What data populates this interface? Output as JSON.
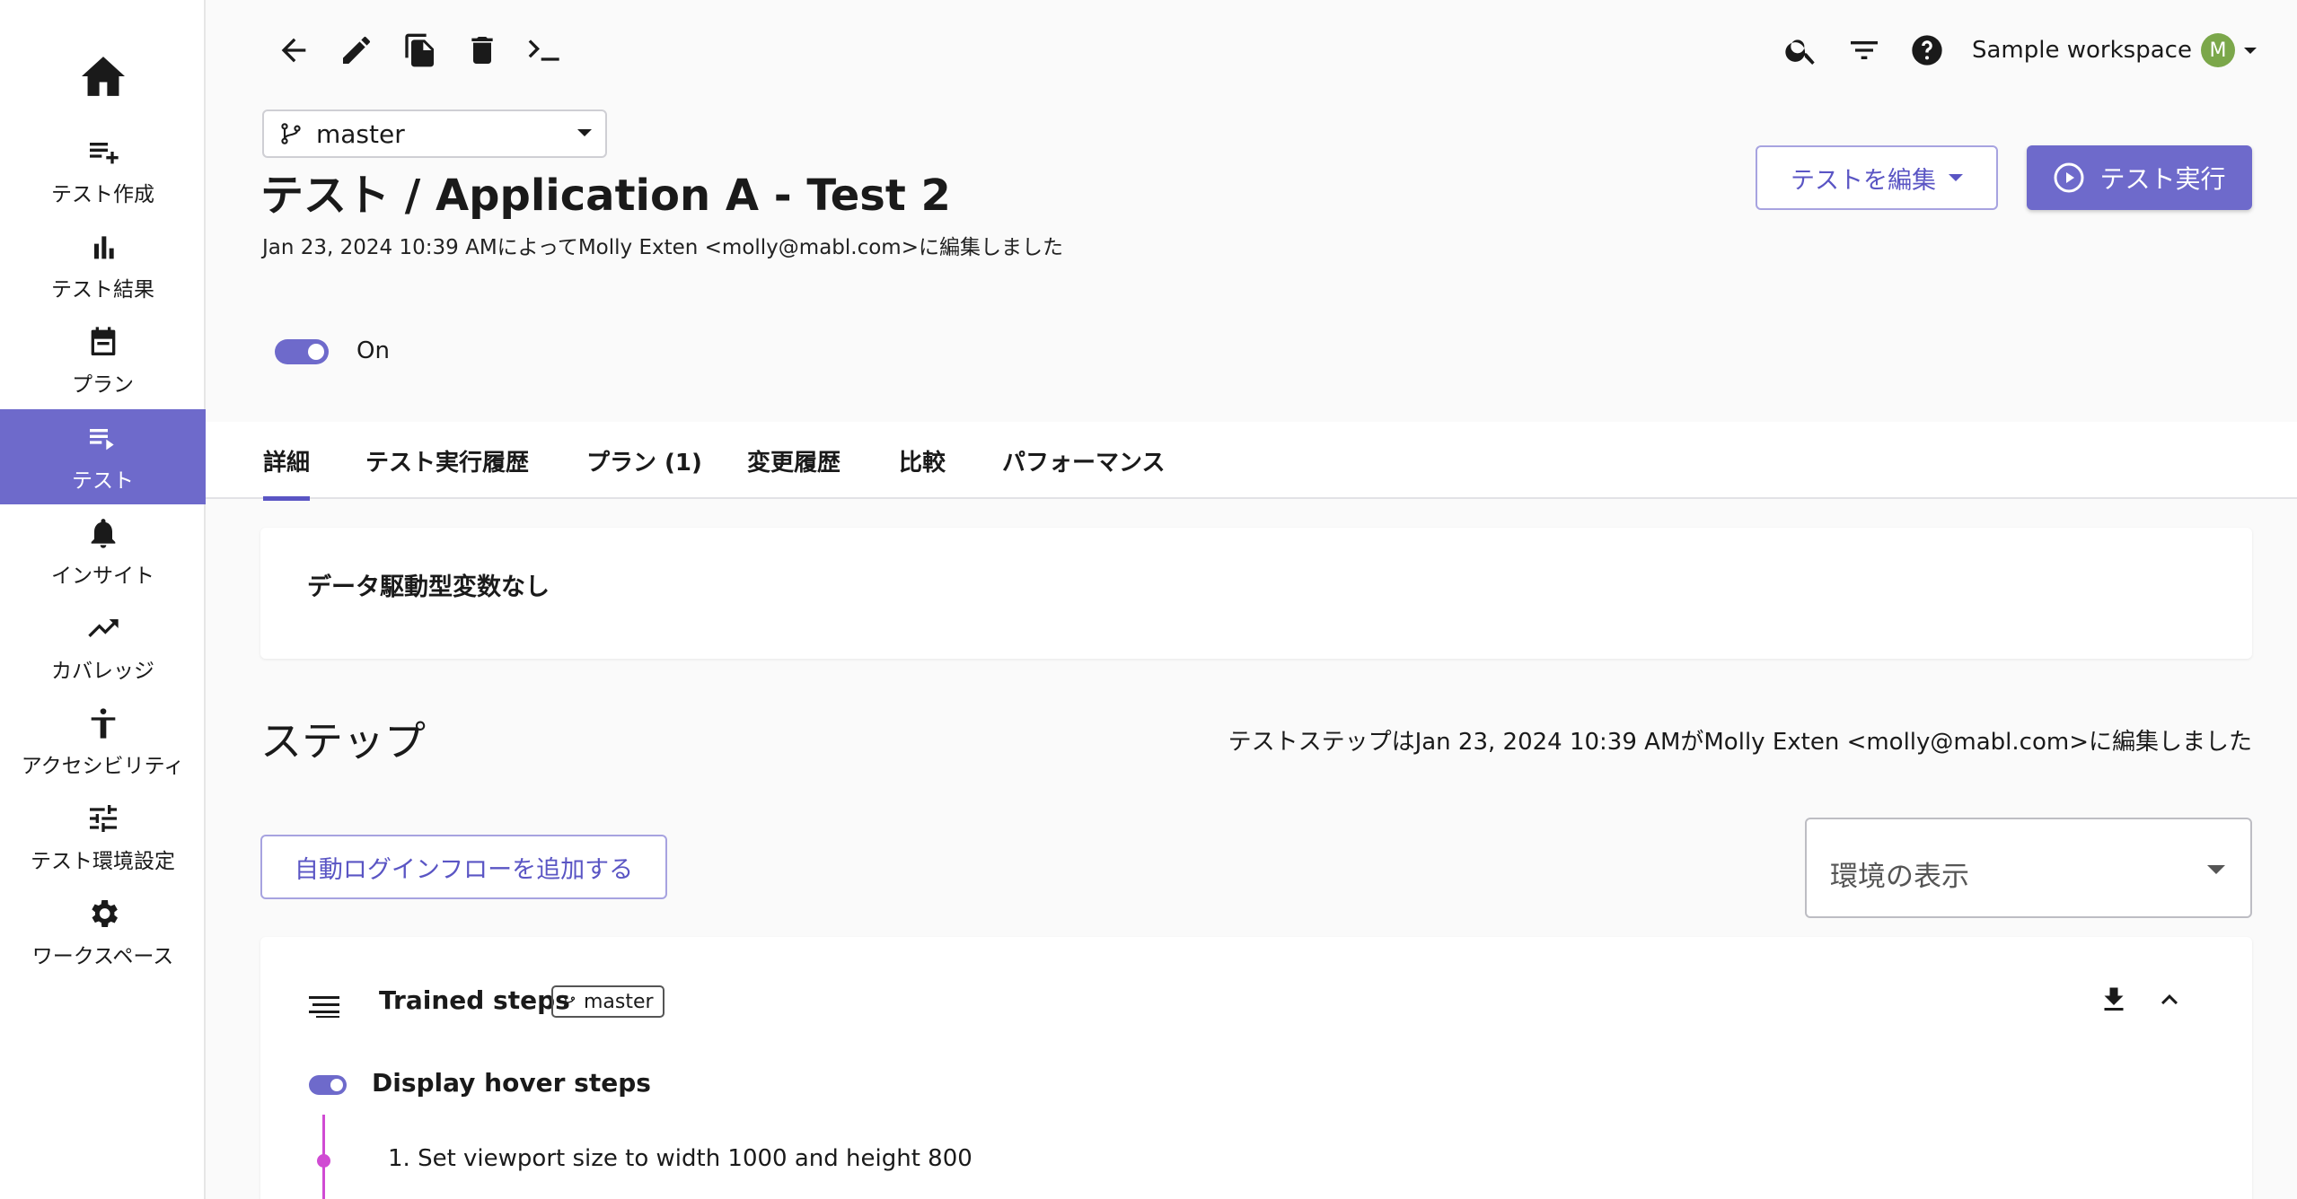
{
  "sidebar": {
    "items": [
      {
        "label": "テスト作成",
        "icon": "playlist-add-icon"
      },
      {
        "label": "テスト結果",
        "icon": "bar-chart-icon"
      },
      {
        "label": "プラン",
        "icon": "calendar-icon"
      },
      {
        "label": "テスト",
        "icon": "playlist-play-icon"
      },
      {
        "label": "インサイト",
        "icon": "bell-icon"
      },
      {
        "label": "カバレッジ",
        "icon": "trending-up-icon"
      },
      {
        "label": "アクセシビリティ",
        "icon": "accessibility-icon"
      },
      {
        "label": "テスト環境設定",
        "icon": "tune-icon"
      },
      {
        "label": "ワークスペース",
        "icon": "gear-icon"
      }
    ]
  },
  "header": {
    "branch": "master",
    "title": "テスト / Application A - Test 2",
    "edited_by": "Jan 23, 2024 10:39 AMによってMolly Exten <molly@mabl.com>に編集しました",
    "toggle_label": "On",
    "edit_button": "テストを編集",
    "run_button": "テスト実行",
    "workspace_name": "Sample workspace",
    "avatar_letter": "M"
  },
  "tabs": [
    "詳細",
    "テスト実行履歴",
    "プラン (1)",
    "変更履歴",
    "比較",
    "パフォーマンス"
  ],
  "details": {
    "ddv_text": "データ駆動型変数なし"
  },
  "steps": {
    "heading": "ステップ",
    "edited_by": "テストステップはJan 23, 2024 10:39 AMがMolly Exten <molly@mabl.com>に編集しました",
    "add_login_button": "自動ログインフローを追加する",
    "env_placeholder": "環境の表示",
    "trained_title": "Trained steps",
    "trained_branch": "master",
    "hover_label": "Display hover steps",
    "step_1": "1. Set viewport size to width 1000 and height 800"
  },
  "colors": {
    "accent": "#6e6acb",
    "timeline": "#d04bd3",
    "avatar": "#7ba74a"
  }
}
